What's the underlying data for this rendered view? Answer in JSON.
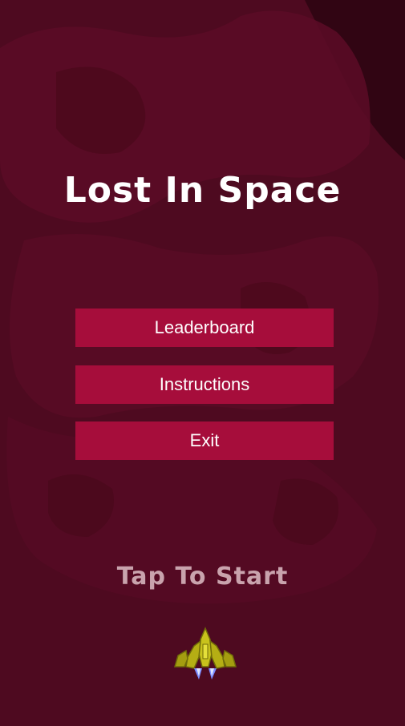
{
  "game": {
    "title": "Lost In Space",
    "menu": {
      "leaderboard_label": "Leaderboard",
      "instructions_label": "Instructions",
      "exit_label": "Exit"
    },
    "prompt": "Tap To Start",
    "player_sprite": "spaceship-icon"
  },
  "colors": {
    "background": "#4e0a20",
    "button": "#a60d3b",
    "title": "#ffffff",
    "prompt": "#c9a3ad"
  }
}
